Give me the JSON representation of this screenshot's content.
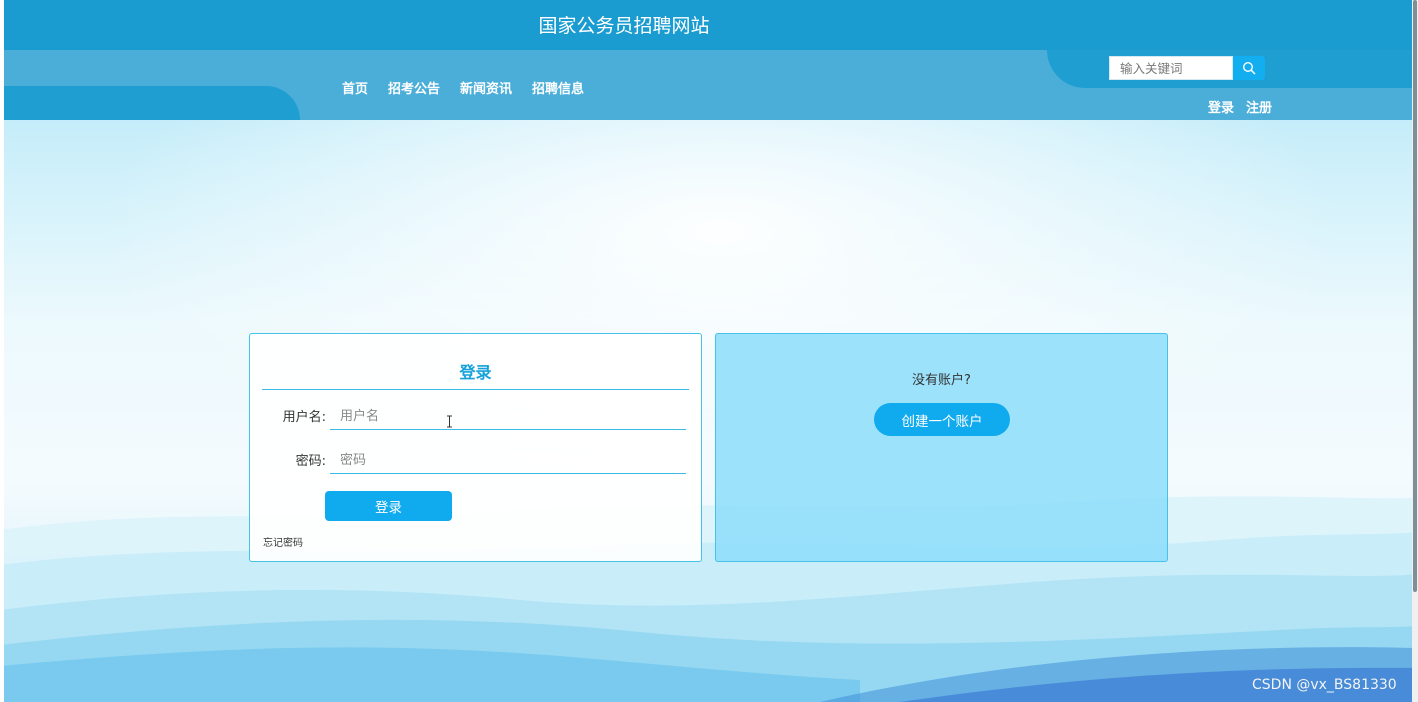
{
  "header": {
    "site_title": "国家公务员招聘网站",
    "nav": [
      {
        "label": "首页"
      },
      {
        "label": "招考公告"
      },
      {
        "label": "新闻资讯"
      },
      {
        "label": "招聘信息"
      }
    ],
    "search": {
      "placeholder": "输入关键词",
      "value": "",
      "icon": "search-icon"
    },
    "auth": {
      "login_label": "登录",
      "register_label": "注册"
    }
  },
  "login_form": {
    "title": "登录",
    "username_label": "用户名:",
    "username_placeholder": "用户名",
    "password_label": "密码:",
    "password_placeholder": "密码",
    "submit_label": "登录",
    "forgot_label": "忘记密码"
  },
  "register_panel": {
    "prompt": "没有账户?",
    "create_label": "创建一个账户"
  },
  "watermark": "CSDN @vx_BS81330",
  "colors": {
    "header_dark": "#1a9cd0",
    "header_light": "#4baed9",
    "accent": "#10aaee",
    "title_blue": "#16a2d8",
    "register_panel_bg": "#8fdefa"
  }
}
